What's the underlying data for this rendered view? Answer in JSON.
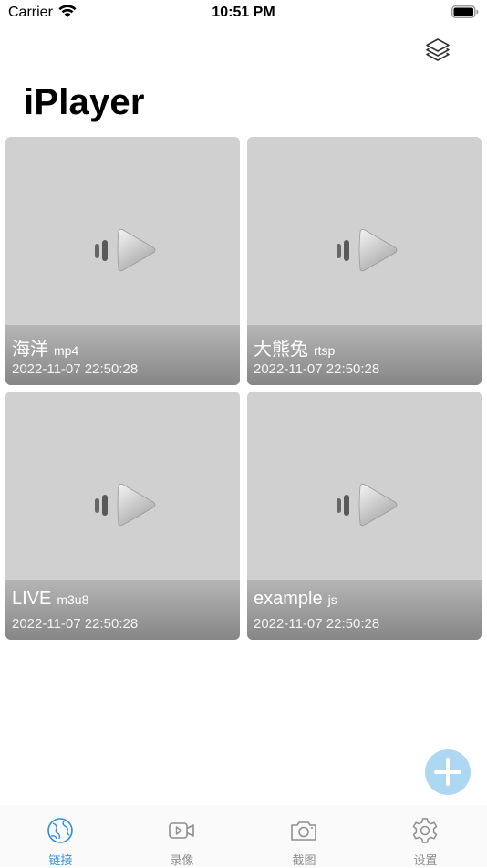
{
  "status_bar": {
    "carrier": "Carrier",
    "time": "10:51 PM"
  },
  "header": {
    "title": "iPlayer",
    "layers_icon": "layers-icon"
  },
  "items": [
    {
      "name": "海洋",
      "type": "mp4",
      "date": "2022-11-07 22:50:28"
    },
    {
      "name": "大熊兔",
      "type": "rtsp",
      "date": "2022-11-07 22:50:28"
    },
    {
      "name": "LIVE",
      "type": "m3u8",
      "date": "2022-11-07 22:50:28"
    },
    {
      "name": "example",
      "type": "js",
      "date": "2022-11-07 22:50:28"
    }
  ],
  "add_button": {
    "icon": "plus-icon",
    "color": "#aed8f2"
  },
  "tab_bar": {
    "active_color": "#2f8fe4",
    "inactive_color": "#8e8e93",
    "tabs": [
      {
        "label": "链接",
        "icon": "globe-icon",
        "active": true
      },
      {
        "label": "录像",
        "icon": "video-camera-icon",
        "active": false
      },
      {
        "label": "截图",
        "icon": "camera-icon",
        "active": false
      },
      {
        "label": "设置",
        "icon": "gear-icon",
        "active": false
      }
    ]
  }
}
